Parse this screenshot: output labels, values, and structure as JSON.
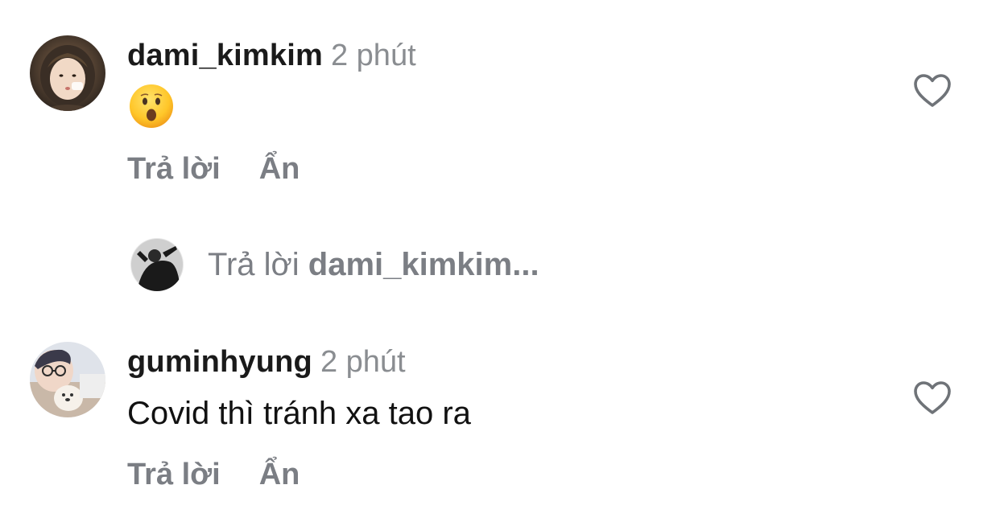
{
  "comments": [
    {
      "username": "dami_kimkim",
      "time": "2 phút",
      "avatar": "profile-photo-girl",
      "content_emoji": "face-with-open-mouth-emoji",
      "content_text": "",
      "reply_label": "Trả lời",
      "hide_label": "Ẩn",
      "like_icon": "heart-outline-icon"
    },
    {
      "username": "guminhyung",
      "time": "2 phút",
      "avatar": "profile-photo-boy",
      "content_text": "Covid thì tránh xa tao ra",
      "reply_label": "Trả lời",
      "hide_label": "Ẩn",
      "like_icon": "heart-outline-icon"
    }
  ],
  "reply_prompt": {
    "prefix": "Trả lời",
    "username": "dami_kimkim..."
  },
  "colors": {
    "text_primary": "#111111",
    "text_secondary": "#7b7e84",
    "heart_stroke": "#6f7378",
    "background": "#ffffff"
  }
}
